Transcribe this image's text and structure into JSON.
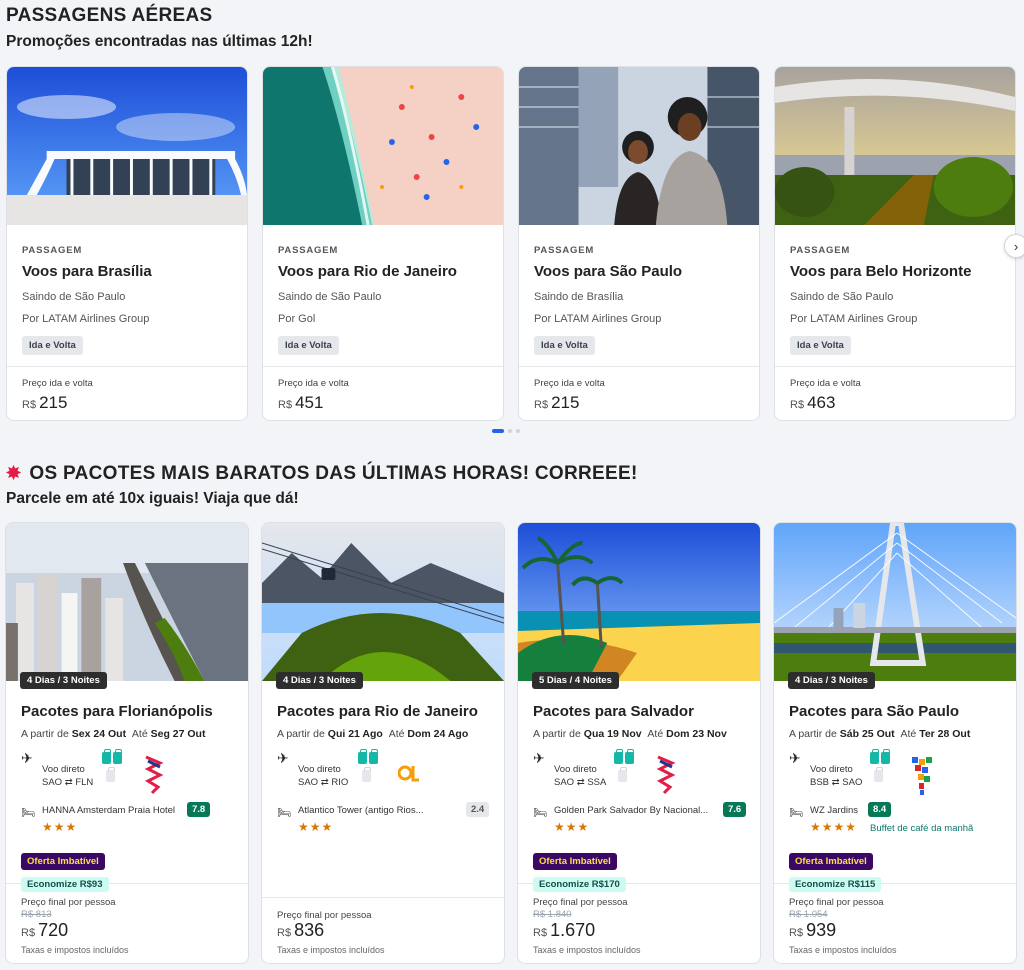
{
  "flights": {
    "title": "PASSAGENS AÉREAS",
    "subtitle": "Promoções encontradas nas últimas 12h!",
    "cards": [
      {
        "kicker": "PASSAGEM",
        "title": "Voos para Brasília",
        "origin": "Saindo de São Paulo",
        "airline": "Por LATAM Airlines Group",
        "chip": "Ida e Volta",
        "price_label": "Preço ida e volta",
        "currency": "R$",
        "price": "215"
      },
      {
        "kicker": "PASSAGEM",
        "title": "Voos para Rio de Janeiro",
        "origin": "Saindo de São Paulo",
        "airline": "Por Gol",
        "chip": "Ida e Volta",
        "price_label": "Preço ida e volta",
        "currency": "R$",
        "price": "451"
      },
      {
        "kicker": "PASSAGEM",
        "title": "Voos para São Paulo",
        "origin": "Saindo de Brasília",
        "airline": "Por LATAM Airlines Group",
        "chip": "Ida e Volta",
        "price_label": "Preço ida e volta",
        "currency": "R$",
        "price": "215"
      },
      {
        "kicker": "PASSAGEM",
        "title": "Voos para Belo Horizonte",
        "origin": "Saindo de São Paulo",
        "airline": "Por LATAM Airlines Group",
        "chip": "Ida e Volta",
        "price_label": "Preço ida e volta",
        "currency": "R$",
        "price": "463"
      }
    ],
    "next_icon": "chevron-right-icon"
  },
  "packages": {
    "title": "OS PACOTES MAIS BARATOS DAS ÚLTIMAS HORAS! CORREEE!",
    "subtitle": "Parcele em até 10x iguais! Viaja que dá!",
    "cards": [
      {
        "nights": "4 Dias / 3 Noites",
        "title": "Pacotes para Florianópolis",
        "from_label": "A partir de",
        "from": "Sex 24 Out",
        "to_label": "Até",
        "to": "Seg 27 Out",
        "voo": "Voo direto",
        "route_from": "SAO",
        "route_to": "FLN",
        "hotel": "HANNA Amsterdam Praia Hotel",
        "score": "7.8",
        "stars": "★★★",
        "oferta": "Oferta Imbatível",
        "economize": "Economize R$93",
        "old_price": "R$ 813",
        "price_label": "Preço final por pessoa",
        "currency": "R$",
        "price": "720",
        "tax": "Taxas e impostos incluídos"
      },
      {
        "nights": "4 Dias / 3 Noites",
        "title": "Pacotes para Rio de Janeiro",
        "from_label": "A partir de",
        "from": "Qui 21 Ago",
        "to_label": "Até",
        "to": "Dom 24 Ago",
        "voo": "Voo direto",
        "route_from": "SAO",
        "route_to": "RIO",
        "hotel": "Atlantico Tower (antigo Rios...",
        "score": "2.4",
        "stars": "★★★",
        "price_label": "Preço final por pessoa",
        "currency": "R$",
        "price": "836",
        "tax": "Taxas e impostos incluídos"
      },
      {
        "nights": "5 Dias / 4 Noites",
        "title": "Pacotes para Salvador",
        "from_label": "A partir de",
        "from": "Qua 19 Nov",
        "to_label": "Até",
        "to": "Dom 23 Nov",
        "voo": "Voo direto",
        "route_from": "SAO",
        "route_to": "SSA",
        "hotel": "Golden Park Salvador By Nacional...",
        "score": "7.6",
        "stars": "★★★",
        "oferta": "Oferta Imbatível",
        "economize": "Economize R$170",
        "old_price": "R$ 1.840",
        "price_label": "Preço final por pessoa",
        "currency": "R$",
        "price": "1.670",
        "tax": "Taxas e impostos incluídos"
      },
      {
        "nights": "4 Dias / 3 Noites",
        "title": "Pacotes para São Paulo",
        "from_label": "A partir de",
        "from": "Sáb 25 Out",
        "to_label": "Até",
        "to": "Ter 28 Out",
        "voo": "Voo direto",
        "route_from": "BSB",
        "route_to": "SAO",
        "hotel": "WZ Jardins",
        "score": "8.4",
        "stars": "★★★★",
        "breakfast": "Buffet de café da manhã",
        "oferta": "Oferta Imbatível",
        "economize": "Economize R$115",
        "old_price": "R$ 1.054",
        "price_label": "Preço final por pessoa",
        "currency": "R$",
        "price": "939",
        "tax": "Taxas e impostos incluídos"
      }
    ]
  },
  "colors": {
    "accent": "#2563eb",
    "oferta_bg": "#3b0764",
    "oferta_text": "#fde047",
    "score": "#047857",
    "save_bg": "#ccfbf1"
  }
}
